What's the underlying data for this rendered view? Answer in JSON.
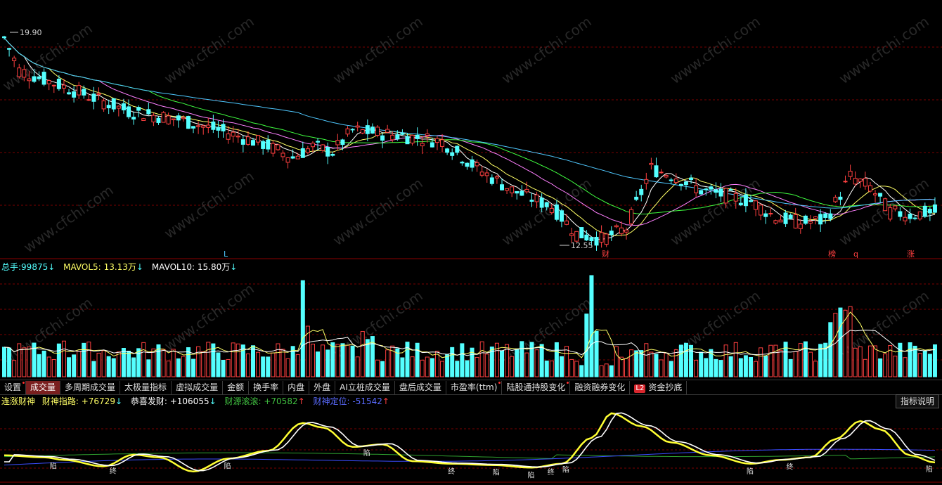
{
  "price_panel": {
    "high_label": "19.90",
    "low_label": "12.55",
    "markers": [
      "L",
      "财",
      "榜",
      "q",
      "涨"
    ],
    "watermark": "www.cfchi.com"
  },
  "volume_panel": {
    "label_total": "总手:",
    "value_total": "99875",
    "label_ma5": "MAVOL5:",
    "value_ma5": "13.13万",
    "label_ma10": "MAVOL10:",
    "value_ma10": "15.80万"
  },
  "tabs": [
    {
      "label": "设置",
      "dot": true
    },
    {
      "label": "成交量",
      "active": true
    },
    {
      "label": "多周期成交量"
    },
    {
      "label": "太极量指标"
    },
    {
      "label": "虚拟成交量"
    },
    {
      "label": "金额"
    },
    {
      "label": "换手率"
    },
    {
      "label": "内盘"
    },
    {
      "label": "外盘"
    },
    {
      "label": "AI立桩成交量"
    },
    {
      "label": "盘后成交量"
    },
    {
      "label": "市盈率(ttm)",
      "dot": true
    },
    {
      "label": "陆股通持股变化",
      "dot": true
    },
    {
      "label": "融资融券变化"
    },
    {
      "label": "资金抄底",
      "badge": "L2"
    }
  ],
  "indicator": {
    "name": "连涨财神",
    "l1": "财神指路:",
    "v1": "+76729",
    "l2": "恭喜发财:",
    "v2": "+106055",
    "l3": "财源滚滚:",
    "v3": "+70582",
    "l4": "财神定位:",
    "v4": "-51542",
    "help": "指标说明",
    "signal_text": "陷",
    "signal_end": "终"
  },
  "colors": {
    "up": "#ff4040",
    "down": "#54ffff",
    "ma5": "#ffffff",
    "ma10": "#ffff66",
    "ma20": "#ff80ff",
    "ma30": "#40ff40",
    "ma60": "#4fc8ff",
    "grid": "#7a0000"
  }
}
